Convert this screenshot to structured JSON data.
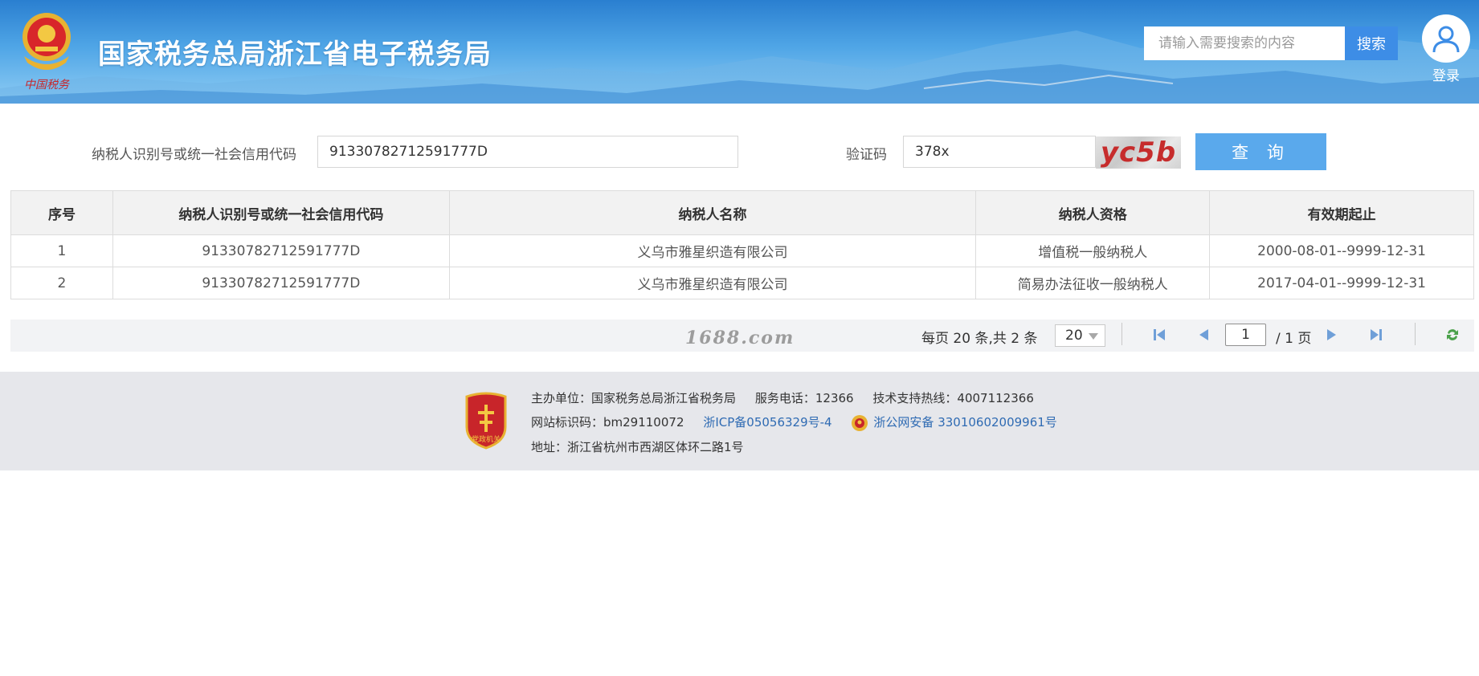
{
  "header": {
    "site_title": "国家税务总局浙江省电子税务局",
    "emblem_caption": "中国税务",
    "search_placeholder": "请输入需要搜索的内容",
    "search_button": "搜索",
    "login_label": "登录"
  },
  "query_form": {
    "taxpayer_id_label": "纳税人识别号或统一社会信用代码",
    "taxpayer_id_value": "91330782712591777D",
    "captcha_label": "验证码",
    "captcha_value": "378x",
    "captcha_image_text": "yc5b",
    "query_button": "查 询"
  },
  "results_table": {
    "columns": [
      "序号",
      "纳税人识别号或统一社会信用代码",
      "纳税人名称",
      "纳税人资格",
      "有效期起止"
    ],
    "rows": [
      [
        "1",
        "91330782712591777D",
        "义乌市雅星织造有限公司",
        "增值税一般纳税人",
        "2000-08-01--9999-12-31"
      ],
      [
        "2",
        "91330782712591777D",
        "义乌市雅星织造有限公司",
        "简易办法征收一般纳税人",
        "2017-04-01--9999-12-31"
      ]
    ]
  },
  "pager": {
    "watermark": "1688.com",
    "summary": "每页 20 条,共 2 条",
    "page_size": "20",
    "current_page": "1",
    "total_pages_text": "/ 1 页"
  },
  "footer": {
    "sponsor": "主办单位：国家税务总局浙江省税务局",
    "service_phone": "服务电话：12366",
    "support_hotline": "技术支持热线：4007112366",
    "site_id": "网站标识码：bm29110072",
    "icp": "浙ICP备05056329号-4",
    "police_record": "浙公网安备 33010602009961号",
    "address": "地址：浙江省杭州市西湖区体环二路1号",
    "badge_caption": "党政机关"
  },
  "colors": {
    "header_blue": "#2a7fd0",
    "search_button": "#3d8de6",
    "query_button": "#5aa9ec",
    "link": "#2f6bb3",
    "captcha_text": "#c62c2c"
  }
}
